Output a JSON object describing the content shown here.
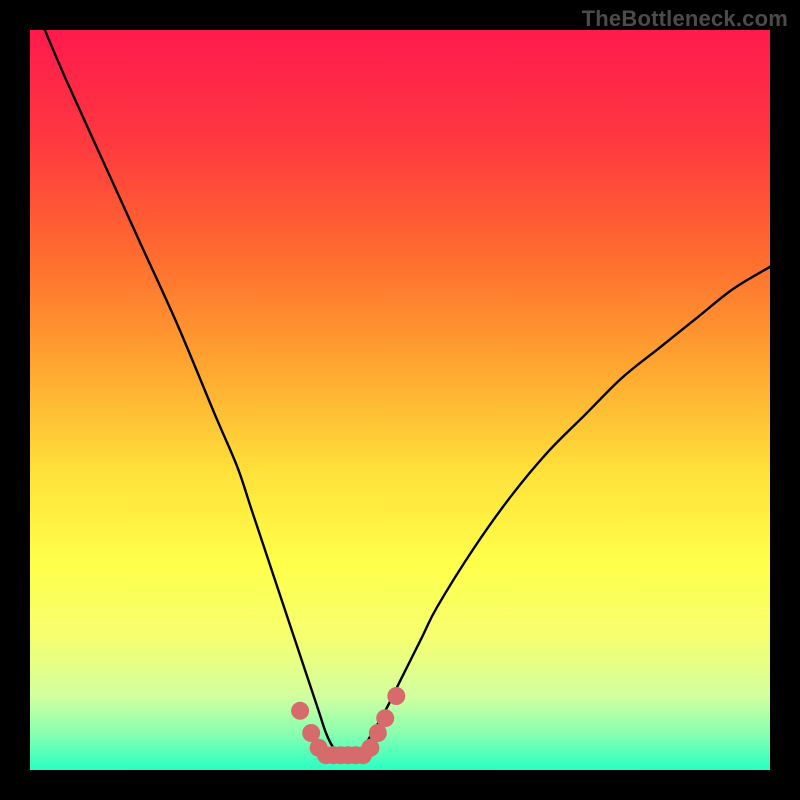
{
  "watermark": "TheBottleneck.com",
  "chart_data": {
    "type": "line",
    "title": "",
    "xlabel": "",
    "ylabel": "",
    "xlim": [
      0,
      100
    ],
    "ylim": [
      0,
      100
    ],
    "grid": false,
    "series": [
      {
        "name": "bottleneck-curve",
        "color": "#000000",
        "x": [
          2,
          5,
          10,
          15,
          20,
          25,
          28,
          30,
          33,
          35,
          37,
          39,
          40,
          41,
          42,
          43,
          44,
          45,
          48,
          50,
          53,
          55,
          60,
          65,
          70,
          75,
          80,
          85,
          90,
          95,
          100
        ],
        "y": [
          100,
          93,
          82,
          71,
          60,
          48,
          41,
          35,
          26,
          20,
          14,
          8,
          5,
          3,
          2,
          2,
          2,
          3,
          8,
          12,
          18,
          22,
          30,
          37,
          43,
          48,
          53,
          57,
          61,
          65,
          68
        ]
      },
      {
        "name": "marker-cluster",
        "color": "#d66b6b",
        "type": "scatter",
        "x": [
          36.5,
          38,
          39,
          40,
          41,
          42,
          43,
          44,
          45,
          46,
          47,
          48,
          49.5
        ],
        "y": [
          8,
          5,
          3,
          2,
          2,
          2,
          2,
          2,
          2,
          3,
          5,
          7,
          10
        ]
      }
    ],
    "background_gradient": {
      "stops": [
        {
          "pos": 0.0,
          "color": "#ff1a4d"
        },
        {
          "pos": 0.15,
          "color": "#ff3840"
        },
        {
          "pos": 0.3,
          "color": "#ff6a2f"
        },
        {
          "pos": 0.45,
          "color": "#ffa430"
        },
        {
          "pos": 0.6,
          "color": "#ffe23a"
        },
        {
          "pos": 0.72,
          "color": "#ffff4a"
        },
        {
          "pos": 0.82,
          "color": "#f6ff70"
        },
        {
          "pos": 0.9,
          "color": "#d2ffa0"
        },
        {
          "pos": 0.95,
          "color": "#8affb0"
        },
        {
          "pos": 1.0,
          "color": "#28ffc2"
        }
      ]
    }
  }
}
